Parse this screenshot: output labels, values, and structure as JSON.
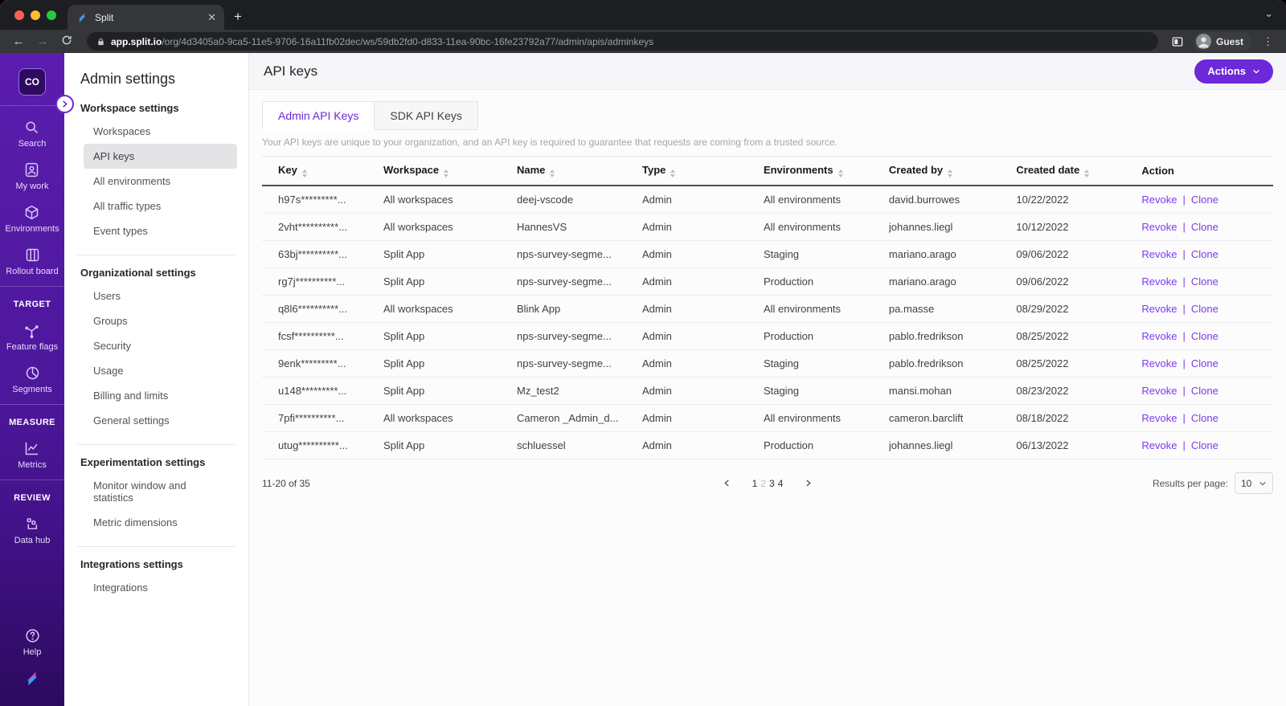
{
  "browser": {
    "tab_title": "Split",
    "url_domain": "app.split.io",
    "url_path": "/org/4d3405a0-9ca5-11e5-9706-16a11fb02dec/ws/59db2fd0-d833-11ea-90bc-16fe23792a77/admin/apis/adminkeys",
    "profile_label": "Guest"
  },
  "rail": {
    "logo_text": "CO",
    "top_items": [
      {
        "label": "Search",
        "icon": "search-icon"
      },
      {
        "label": "My work",
        "icon": "user-badge-icon"
      },
      {
        "label": "Environments",
        "icon": "cube-icon"
      },
      {
        "label": "Rollout board",
        "icon": "board-columns-icon"
      }
    ],
    "sections": [
      {
        "title": "TARGET",
        "items": [
          {
            "label": "Feature flags",
            "icon": "feature-flags-icon"
          },
          {
            "label": "Segments",
            "icon": "pie-icon"
          }
        ]
      },
      {
        "title": "MEASURE",
        "items": [
          {
            "label": "Metrics",
            "icon": "line-chart-icon"
          }
        ]
      },
      {
        "title": "REVIEW",
        "items": [
          {
            "label": "Data hub",
            "icon": "data-hub-icon"
          }
        ]
      }
    ],
    "help_label": "Help"
  },
  "admin_nav": {
    "title": "Admin settings",
    "groups": [
      {
        "title": "Workspace settings",
        "items": [
          {
            "label": "Workspaces",
            "active": false
          },
          {
            "label": "API keys",
            "active": true
          },
          {
            "label": "All environments",
            "active": false
          },
          {
            "label": "All traffic types",
            "active": false
          },
          {
            "label": "Event types",
            "active": false
          }
        ]
      },
      {
        "title": "Organizational settings",
        "items": [
          {
            "label": "Users",
            "active": false
          },
          {
            "label": "Groups",
            "active": false
          },
          {
            "label": "Security",
            "active": false
          },
          {
            "label": "Usage",
            "active": false
          },
          {
            "label": "Billing and limits",
            "active": false
          },
          {
            "label": "General settings",
            "active": false
          }
        ]
      },
      {
        "title": "Experimentation settings",
        "items": [
          {
            "label": "Monitor window and statistics",
            "active": false
          },
          {
            "label": "Metric dimensions",
            "active": false
          }
        ]
      },
      {
        "title": "Integrations settings",
        "items": [
          {
            "label": "Integrations",
            "active": false
          }
        ]
      }
    ]
  },
  "main": {
    "title": "API keys",
    "actions_button": "Actions",
    "tabs": [
      {
        "label": "Admin API Keys",
        "active": true
      },
      {
        "label": "SDK API Keys",
        "active": false
      }
    ],
    "description": "Your API keys are unique to your organization, and an API key is required to guarantee that requests are coming from a trusted source.",
    "table": {
      "columns": [
        {
          "label": "Key",
          "field": "key",
          "sortable": true
        },
        {
          "label": "Workspace",
          "field": "workspace",
          "sortable": true
        },
        {
          "label": "Name",
          "field": "name",
          "sortable": true
        },
        {
          "label": "Type",
          "field": "type",
          "sortable": true
        },
        {
          "label": "Environments",
          "field": "environments",
          "sortable": true
        },
        {
          "label": "Created by",
          "field": "created_by",
          "sortable": true
        },
        {
          "label": "Created date",
          "field": "created_date",
          "sortable": true
        },
        {
          "label": "Action",
          "field": "action",
          "sortable": false
        }
      ],
      "action_labels": [
        "Revoke",
        "Clone"
      ],
      "rows": [
        {
          "key": "h97s*********...",
          "workspace": "All workspaces",
          "name": "deej-vscode",
          "type": "Admin",
          "environments": "All environments",
          "created_by": "david.burrowes",
          "created_date": "10/22/2022"
        },
        {
          "key": "2vht**********...",
          "workspace": "All workspaces",
          "name": "HannesVS",
          "type": "Admin",
          "environments": "All environments",
          "created_by": "johannes.liegl",
          "created_date": "10/12/2022"
        },
        {
          "key": "63bj**********...",
          "workspace": "Split App",
          "name": "nps-survey-segme...",
          "type": "Admin",
          "environments": "Staging",
          "created_by": "mariano.arago",
          "created_date": "09/06/2022"
        },
        {
          "key": "rg7j**********...",
          "workspace": "Split App",
          "name": "nps-survey-segme...",
          "type": "Admin",
          "environments": "Production",
          "created_by": "mariano.arago",
          "created_date": "09/06/2022"
        },
        {
          "key": "q8l6**********...",
          "workspace": "All workspaces",
          "name": "Blink App",
          "type": "Admin",
          "environments": "All environments",
          "created_by": "pa.masse",
          "created_date": "08/29/2022"
        },
        {
          "key": "fcsf**********...",
          "workspace": "Split App",
          "name": "nps-survey-segme...",
          "type": "Admin",
          "environments": "Production",
          "created_by": "pablo.fredrikson",
          "created_date": "08/25/2022"
        },
        {
          "key": "9enk*********...",
          "workspace": "Split App",
          "name": "nps-survey-segme...",
          "type": "Admin",
          "environments": "Staging",
          "created_by": "pablo.fredrikson",
          "created_date": "08/25/2022"
        },
        {
          "key": "u148*********...",
          "workspace": "Split App",
          "name": "Mz_test2",
          "type": "Admin",
          "environments": "Staging",
          "created_by": "mansi.mohan",
          "created_date": "08/23/2022"
        },
        {
          "key": "7pfi**********...",
          "workspace": "All workspaces",
          "name": "Cameron _Admin_d...",
          "type": "Admin",
          "environments": "All environments",
          "created_by": "cameron.barclift",
          "created_date": "08/18/2022"
        },
        {
          "key": "utug**********...",
          "workspace": "Split App",
          "name": "schluessel",
          "type": "Admin",
          "environments": "Production",
          "created_by": "johannes.liegl",
          "created_date": "06/13/2022"
        }
      ]
    },
    "pagination": {
      "range_text": "11-20 of 35",
      "pages": [
        "1",
        "2",
        "3",
        "4"
      ],
      "current_page": "2",
      "results_per_page_label": "Results per page:",
      "results_per_page_value": "10"
    }
  },
  "colors": {
    "accent": "#6d28d9",
    "link": "#7c3aed",
    "rail_purple": "#4d179b",
    "selected_nav_bg": "#e4e4e7"
  }
}
